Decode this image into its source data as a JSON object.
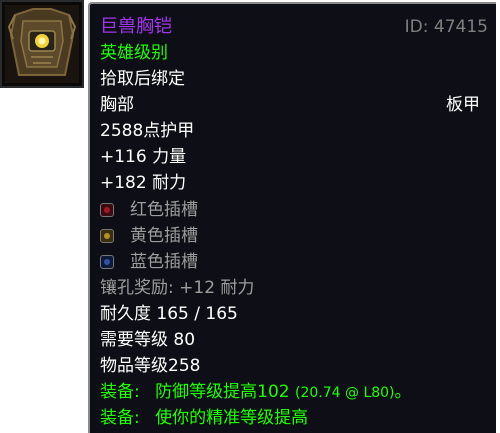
{
  "item": {
    "icon": "chestplate-icon",
    "name": "巨兽胸铠",
    "id_label": "ID: 47415",
    "quality": "英雄级别",
    "binding": "拾取后绑定",
    "slot": "胸部",
    "armor_type": "板甲",
    "armor": "2588点护甲",
    "stat_strength": "+116 力量",
    "stat_stamina": "+182 耐力",
    "sockets": [
      {
        "color": "red",
        "label": "红色插槽"
      },
      {
        "color": "yellow",
        "label": "黄色插槽"
      },
      {
        "color": "blue",
        "label": "蓝色插槽"
      }
    ],
    "socket_bonus": "镶孔奖励: +12 耐力",
    "durability": "耐久度 165 / 165",
    "required_level": "需要等级 80",
    "item_level": "物品等级258",
    "equip_1_prefix": "装备:",
    "equip_1_text": "防御等级提高102",
    "equip_1_detail": "(20.74 @ L80)",
    "equip_1_suffix": "。",
    "equip_2_prefix": "装备:",
    "equip_2_text": "使你的精准等级提高"
  },
  "colors": {
    "epic": "#a335ee",
    "uncommon": "#1eff00",
    "gray": "#9d9d9d",
    "background": "#0e0f16"
  }
}
